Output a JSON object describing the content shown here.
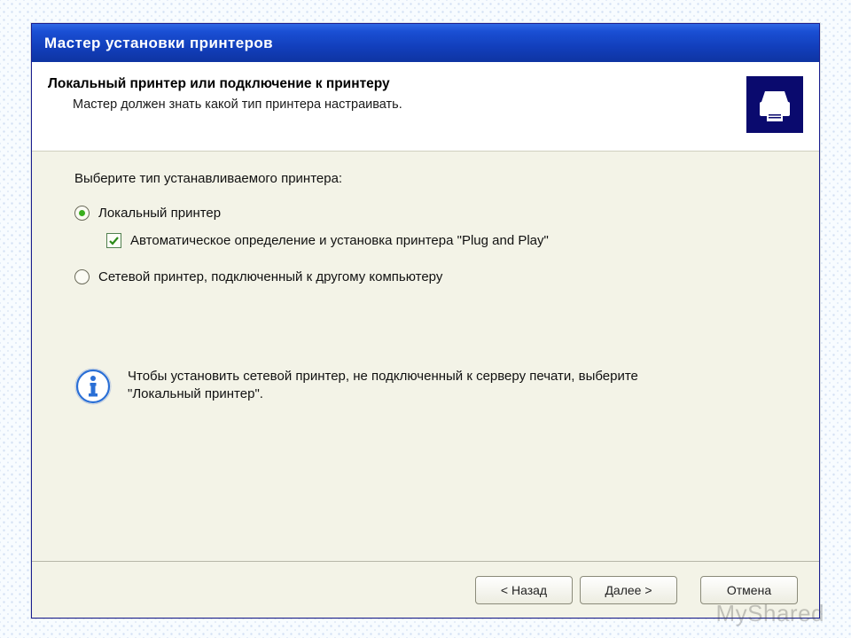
{
  "window": {
    "title": "Мастер установки принтеров"
  },
  "header": {
    "title": "Локальный принтер или подключение к принтеру",
    "subtitle": "Мастер должен знать какой тип принтера настраивать."
  },
  "body": {
    "prompt": "Выберите тип устанавливаемого принтера:",
    "option_local": "Локальный принтер",
    "option_local_selected": true,
    "checkbox_autodetect": "Автоматическое определение и установка принтера \"Plug and Play\"",
    "checkbox_autodetect_checked": true,
    "option_network": "Сетевой принтер, подключенный к другому компьютеру",
    "option_network_selected": false,
    "info_text": "Чтобы установить сетевой принтер, не подключенный к серверу печати, выберите \"Локальный принтер\"."
  },
  "footer": {
    "back": "< Назад",
    "next": "Далее >",
    "cancel": "Отмена"
  },
  "watermark": "MyShared"
}
